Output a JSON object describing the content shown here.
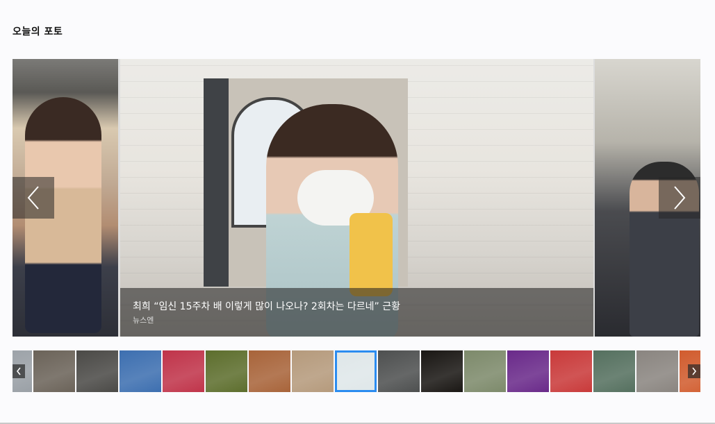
{
  "section": {
    "title": "오늘의 포토"
  },
  "main_slide": {
    "caption_title": "최희 “임신 15주차 배 이렇게 많이 나오나? 2회차는 다르네” 근황",
    "caption_source": "뉴스엔"
  },
  "controls": {
    "prev_icon": "chevron-left-icon",
    "next_icon": "chevron-right-icon"
  },
  "thumbnails": [
    {
      "color": "#9aa0a6"
    },
    {
      "color": "#6b6359"
    },
    {
      "color": "#4b4a47"
    },
    {
      "color": "#3d6fb0"
    },
    {
      "color": "#c0344a"
    },
    {
      "color": "#5d6e2d"
    },
    {
      "color": "#a8643a"
    },
    {
      "color": "#b59a7c"
    },
    {
      "color": "#dfe7e9",
      "active": true
    },
    {
      "color": "#4e5050"
    },
    {
      "color": "#1a1714"
    },
    {
      "color": "#7d8a6b"
    },
    {
      "color": "#6a2a8a"
    },
    {
      "color": "#c93a3a"
    },
    {
      "color": "#55705f"
    },
    {
      "color": "#8a8580"
    },
    {
      "color": "#d15c2e"
    }
  ],
  "colors": {
    "accent": "#2b8cf0",
    "caption_bg": "#1e1e1e",
    "page_bg": "#fbfbfd"
  }
}
